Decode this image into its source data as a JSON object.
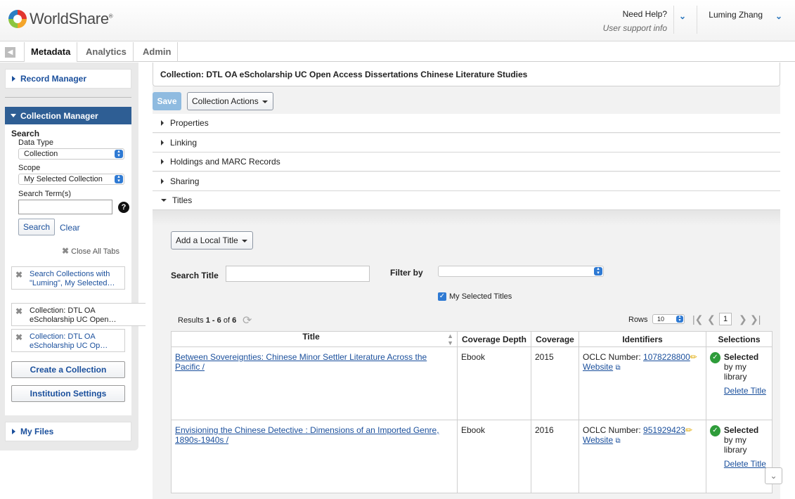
{
  "header": {
    "brand": "WorldShare",
    "brand_mark": "®",
    "help_label": "Need Help?",
    "help_sub": "User support info",
    "user_name": "Luming Zhang"
  },
  "tabs": [
    {
      "label": "Metadata"
    },
    {
      "label": "Analytics"
    },
    {
      "label": "Admin"
    }
  ],
  "sidebar": {
    "record_manager": "Record Manager",
    "collection_manager": "Collection Manager",
    "search_heading": "Search",
    "data_type_label": "Data Type",
    "data_type_value": "Collection",
    "scope_label": "Scope",
    "scope_value": "My Selected Collection",
    "search_term_label": "Search Term(s)",
    "search_term_value": "",
    "search_button": "Search",
    "clear_link": "Clear",
    "close_all_tabs": "Close All Tabs",
    "open_tabs": [
      {
        "text": "Search Collections with \"Luming\", My Selected…"
      },
      {
        "text": "Collection: DTL OA eScholarship UC Open…"
      },
      {
        "text": "Collection: DTL OA eScholarship UC Op…"
      }
    ],
    "create_collection": "Create a Collection",
    "institution_settings": "Institution Settings",
    "my_files": "My Files"
  },
  "main": {
    "collection_title": "Collection: DTL OA eScholarship UC Open Access Dissertations Chinese Literature Studies",
    "save_button": "Save",
    "collection_actions": "Collection Actions",
    "sections": [
      "Properties",
      "Linking",
      "Holdings and MARC Records",
      "Sharing",
      "Titles"
    ],
    "add_local_title": "Add a Local Title",
    "search_title_label": "Search Title",
    "search_title_value": "",
    "filter_by_label": "Filter by",
    "filter_by_value": "",
    "my_selected_titles": "My Selected Titles",
    "results_label": "Results",
    "results_range": "1 - 6",
    "results_of": "of",
    "results_total": "6",
    "rows_label": "Rows",
    "rows_value": "10",
    "page_value": "1",
    "table": {
      "headers": [
        "Title",
        "Coverage Depth",
        "Coverage",
        "Identifiers",
        "Selections"
      ],
      "rows": [
        {
          "title": "Between Sovereignties: Chinese Minor Settler Literature Across the Pacific /",
          "depth": "Ebook",
          "coverage": "2015",
          "oclc_label": "OCLC Number:",
          "oclc_number": "1078228800",
          "website": "Website",
          "selected": "Selected",
          "selected_sub": "by my library",
          "delete": "Delete Title"
        },
        {
          "title": "Envisioning the Chinese Detective : Dimensions of an Imported Genre, 1890s-1940s /",
          "depth": "Ebook",
          "coverage": "2016",
          "oclc_label": "OCLC Number:",
          "oclc_number": "951929423",
          "website": "Website",
          "selected": "Selected",
          "selected_sub": "by my library",
          "delete": "Delete Title"
        }
      ]
    }
  },
  "colors": {
    "nav_blue": "#2e5e94",
    "link_blue": "#1a4f9c",
    "save_disabled": "#8fbbe0",
    "selected_green": "#2e9c3a"
  }
}
